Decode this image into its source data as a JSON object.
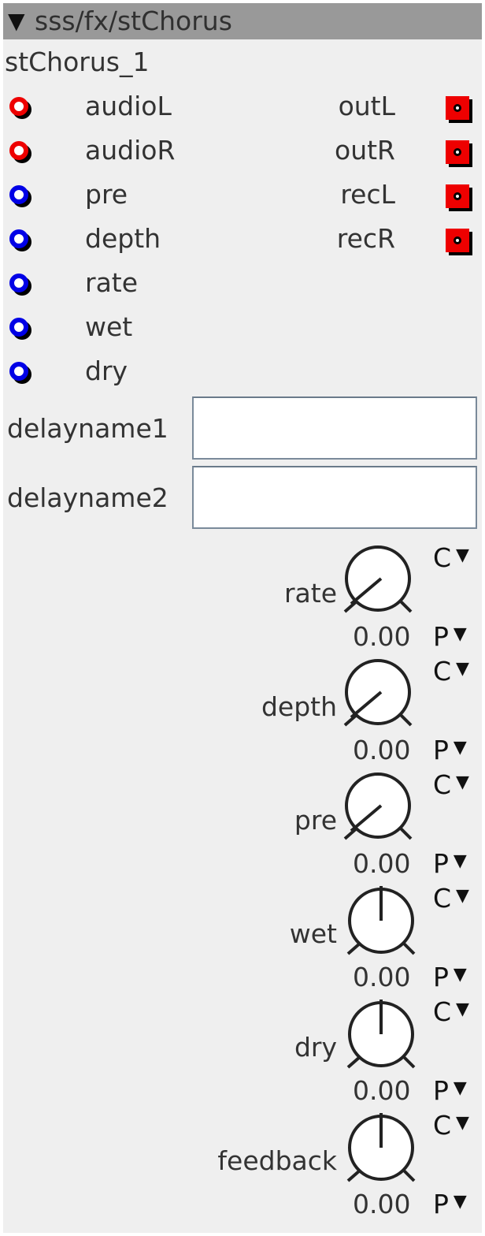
{
  "module": {
    "path": "sss/fx/stChorus",
    "instance": "stChorus_1",
    "collapse_glyph": "▼"
  },
  "inlets": [
    {
      "label": "audioL",
      "kind": "audio"
    },
    {
      "label": "audioR",
      "kind": "audio"
    },
    {
      "label": "pre",
      "kind": "control"
    },
    {
      "label": "depth",
      "kind": "control"
    },
    {
      "label": "rate",
      "kind": "control"
    },
    {
      "label": "wet",
      "kind": "control"
    },
    {
      "label": "dry",
      "kind": "control"
    }
  ],
  "outlets": [
    {
      "label": "outL"
    },
    {
      "label": "outR"
    },
    {
      "label": "recL"
    },
    {
      "label": "recR"
    }
  ],
  "fields": [
    {
      "label": "delayname1",
      "value": ""
    },
    {
      "label": "delayname2",
      "value": ""
    }
  ],
  "knobs": [
    {
      "label": "rate",
      "value": "0.00",
      "style": "unipolar",
      "mode_c": "C",
      "mode_p": "P"
    },
    {
      "label": "depth",
      "value": "0.00",
      "style": "unipolar",
      "mode_c": "C",
      "mode_p": "P"
    },
    {
      "label": "pre",
      "value": "0.00",
      "style": "unipolar",
      "mode_c": "C",
      "mode_p": "P"
    },
    {
      "label": "wet",
      "value": "0.00",
      "style": "bipolar",
      "mode_c": "C",
      "mode_p": "P"
    },
    {
      "label": "dry",
      "value": "0.00",
      "style": "bipolar",
      "mode_c": "C",
      "mode_p": "P"
    },
    {
      "label": "feedback",
      "value": "0.00",
      "style": "bipolar",
      "mode_c": "C",
      "mode_p": "P"
    }
  ],
  "dropdown_glyph": "▼",
  "colors": {
    "audio_port": "#ee0000",
    "control_port": "#0000e6",
    "header": "#999999",
    "panel": "#efefef"
  }
}
